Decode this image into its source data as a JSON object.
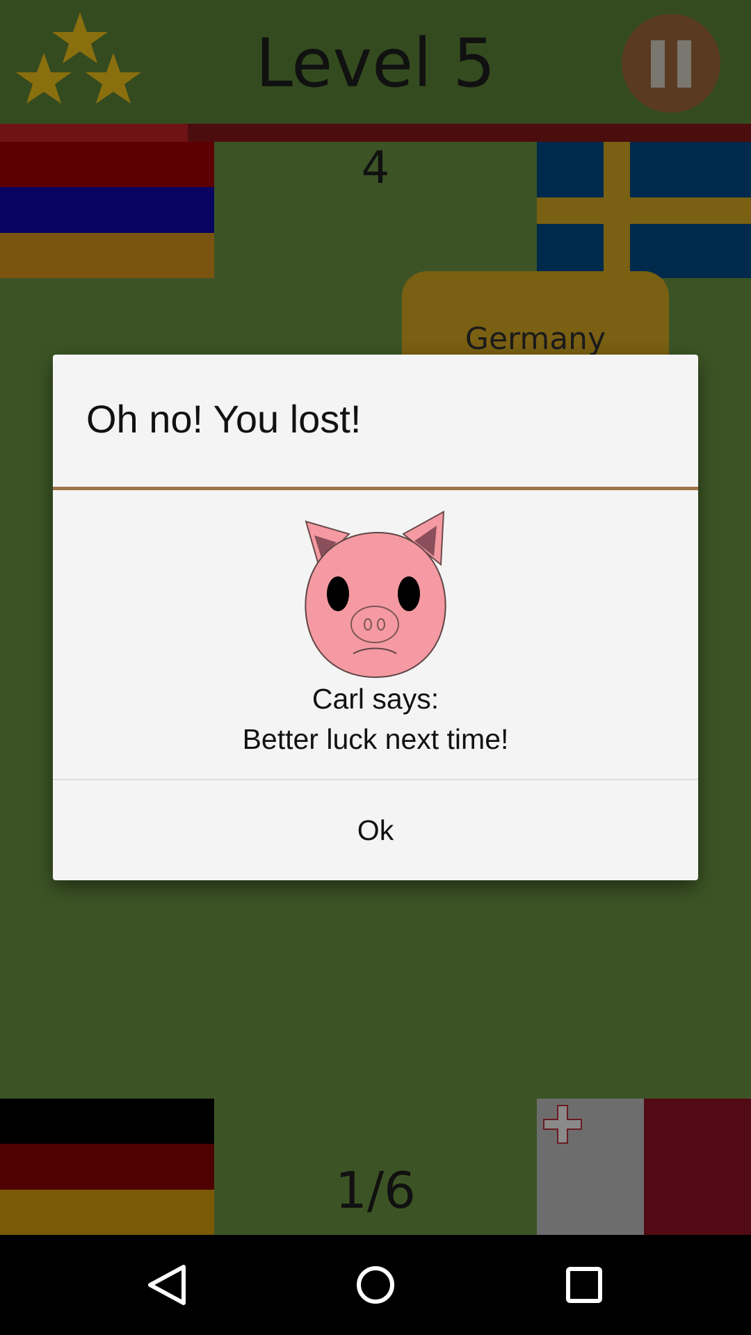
{
  "header": {
    "level_title": "Level 5",
    "stars_earned": 3,
    "star_color": "#8a6f0f",
    "pause_icon": "pause-icon"
  },
  "game": {
    "timer_remaining_fraction": 0.25,
    "score_top": "4",
    "progress": "1/6",
    "answer_option": "Germany",
    "flags": [
      "Armenia",
      "Sweden",
      "Germany",
      "Malta"
    ]
  },
  "dialog": {
    "title": "Oh no! You lost!",
    "speaker": "Carl says:",
    "message": "Better luck next time!",
    "ok_label": "Ok",
    "mascot_icon": "sad-pig-icon",
    "divider_color": "#a0734a"
  },
  "navbar": {
    "back_icon": "back-triangle-icon",
    "home_icon": "home-circle-icon",
    "recents_icon": "recents-square-icon"
  }
}
